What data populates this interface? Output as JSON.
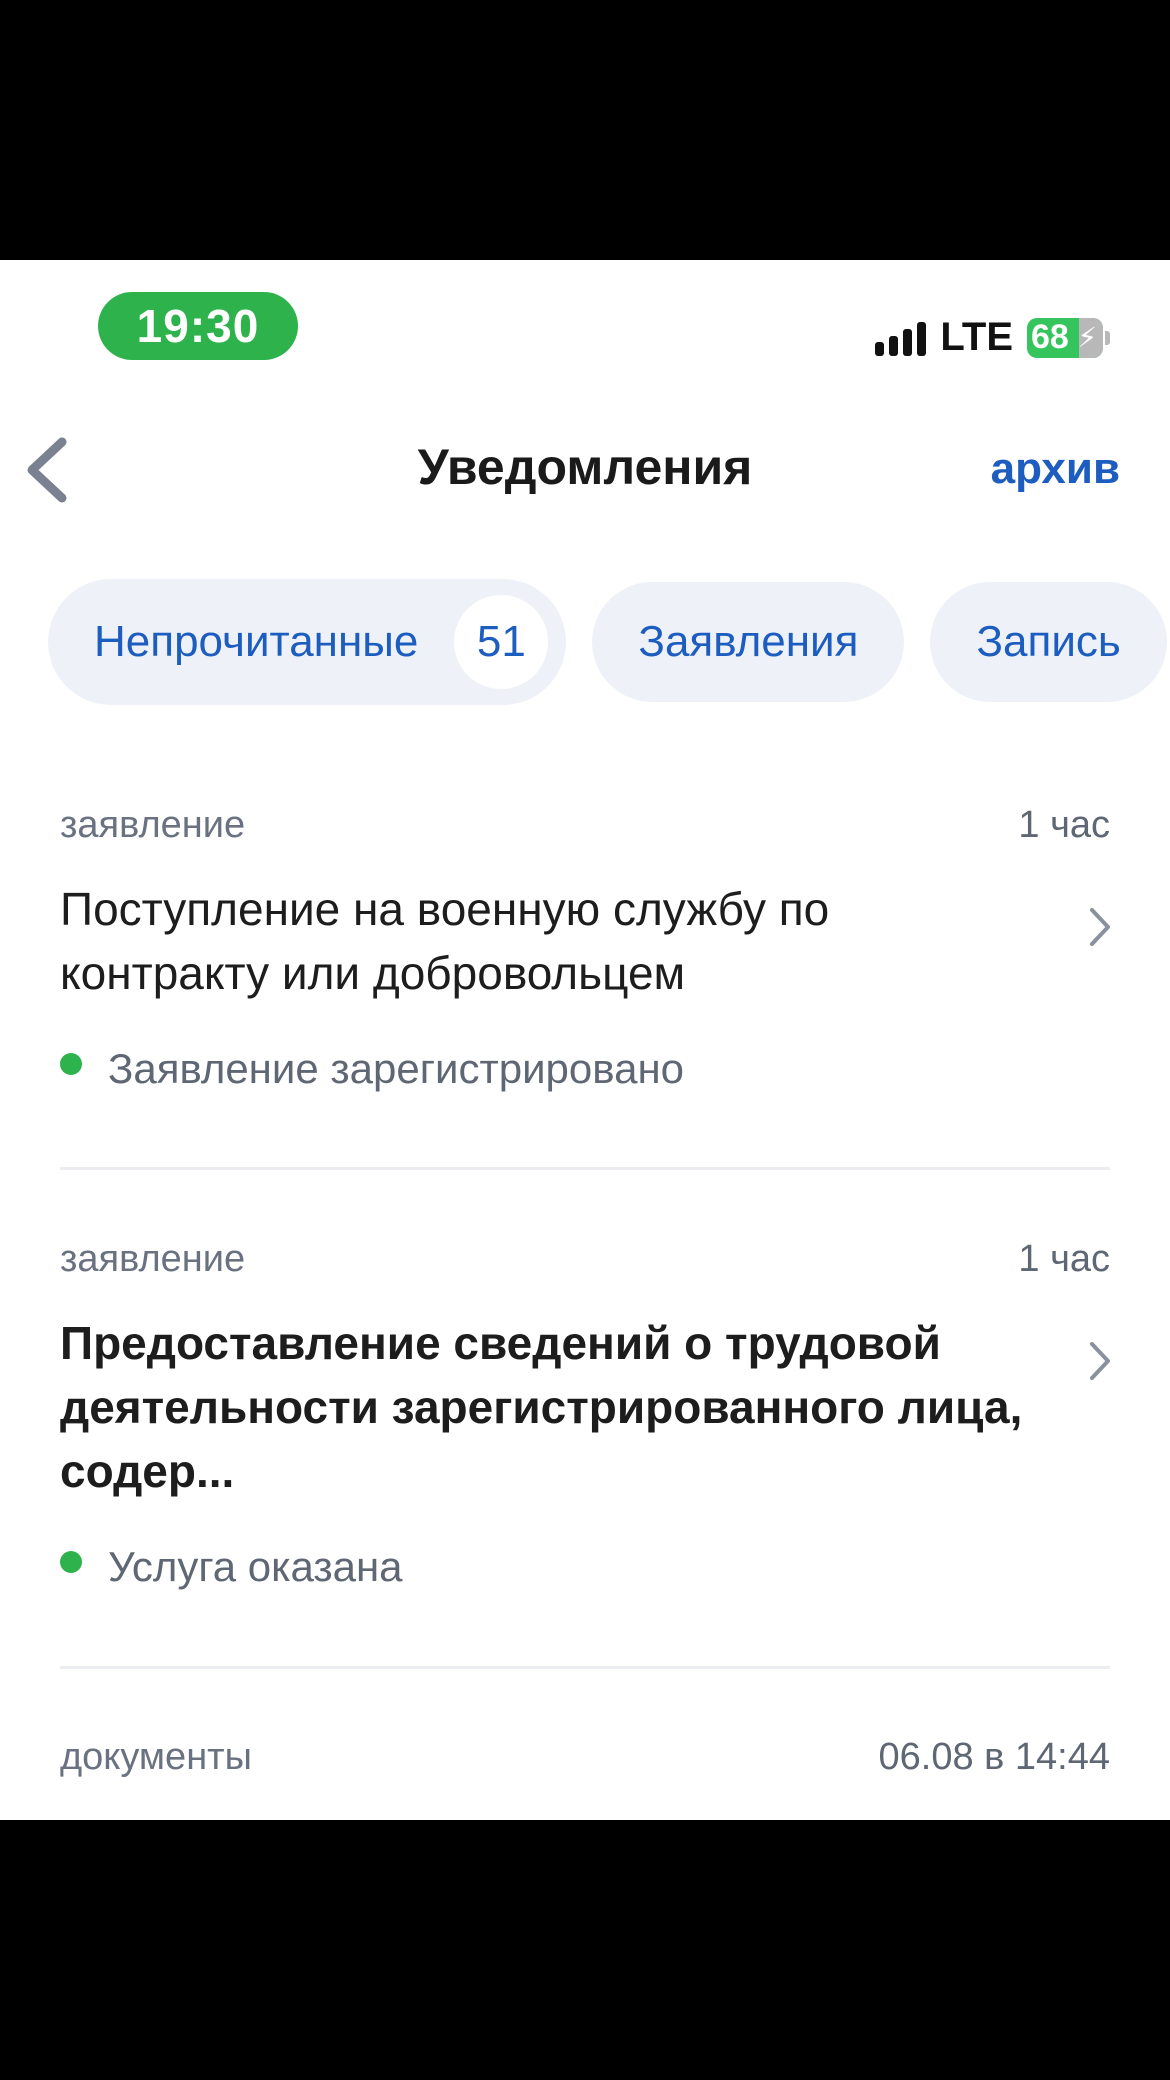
{
  "status_bar": {
    "time": "19:30",
    "network": "LTE",
    "battery_level": "68"
  },
  "header": {
    "title": "Уведомления",
    "archive_label": "архив"
  },
  "filters": [
    {
      "label": "Непрочитанные",
      "count": "51"
    },
    {
      "label": "Заявления"
    },
    {
      "label": "Запись"
    }
  ],
  "notifications": [
    {
      "category": "заявление",
      "time": "1 час",
      "title": "Поступление на военную службу по контракту или добровольцем",
      "status": "Заявление зарегистрировано",
      "status_color": "#2eb24c",
      "unread": false
    },
    {
      "category": "заявление",
      "time": "1 час",
      "title": "Предоставление сведений о трудовой деятельности зарегистрированного лица, содер...",
      "status": "Услуга оказана",
      "status_color": "#2eb24c",
      "unread": true
    },
    {
      "category": "документы",
      "time": "06.08 в 14:44"
    }
  ],
  "colors": {
    "accent": "#1d5dbf",
    "success": "#2eb24c",
    "chip_bg": "#eef2f8"
  }
}
